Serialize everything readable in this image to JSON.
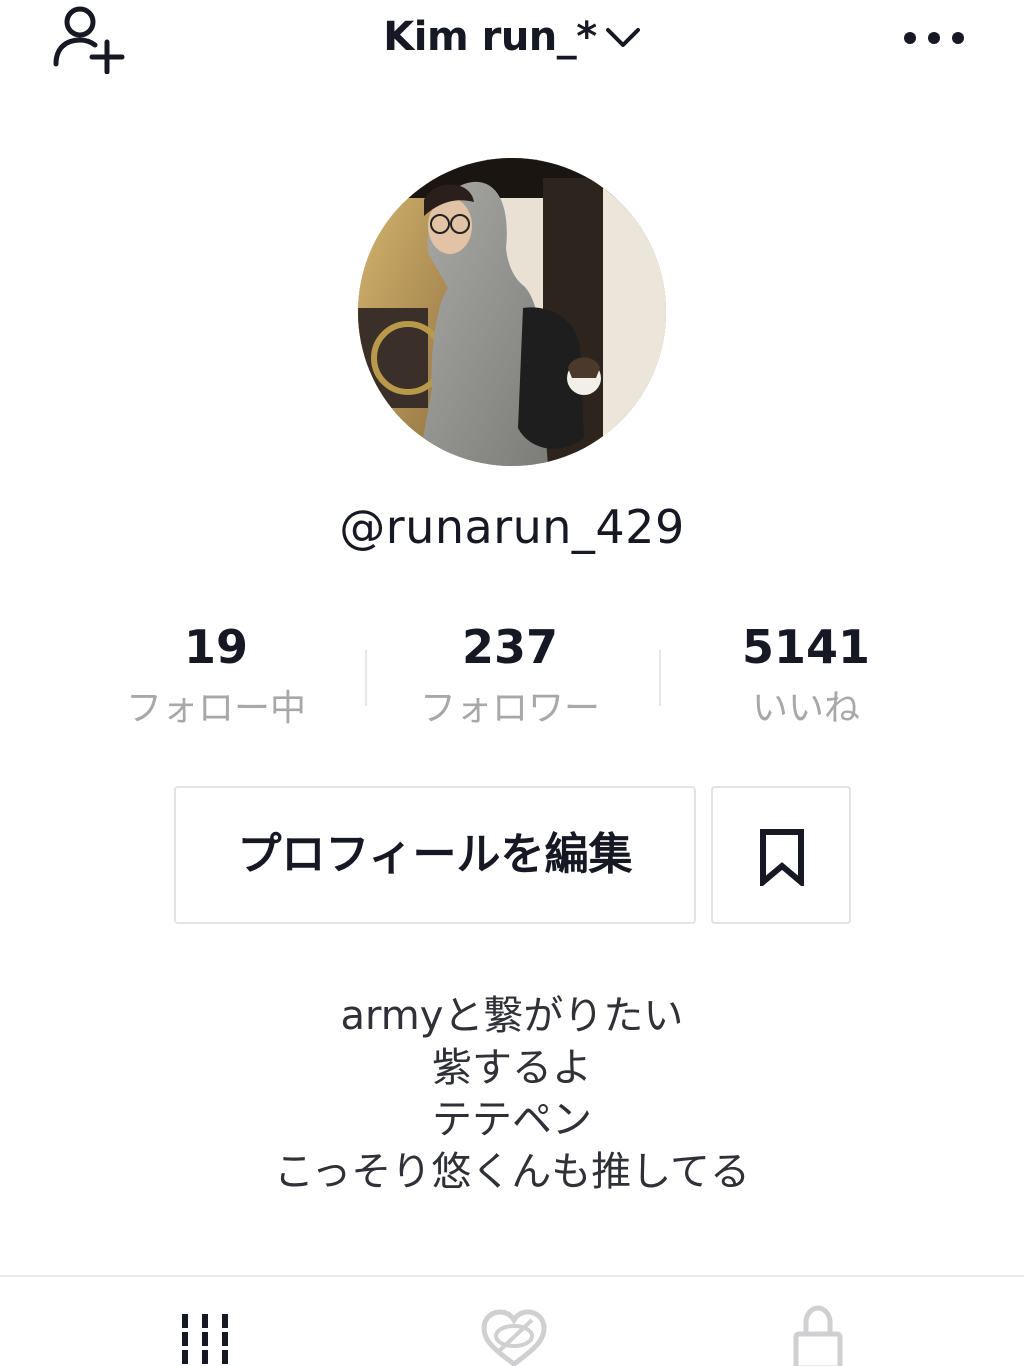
{
  "header": {
    "title": "Kim run_*",
    "add_friend_icon": "person-plus-icon",
    "more_icon": "more-horizontal-icon",
    "dropdown_icon": "chevron-down-icon"
  },
  "profile": {
    "handle": "@runarun_429",
    "avatar_icon": "profile-photo"
  },
  "stats": [
    {
      "value": "19",
      "label": "フォロー中"
    },
    {
      "value": "237",
      "label": "フォロワー"
    },
    {
      "value": "5141",
      "label": "いいね"
    }
  ],
  "actions": {
    "edit_profile_label": "プロフィールを編集",
    "bookmark_icon": "bookmark-icon"
  },
  "bio": {
    "lines": [
      "armyと繋がりたい",
      "紫するよ",
      "テテペン",
      "こっそり悠くんも推してる"
    ]
  },
  "tabs": [
    {
      "name": "videos",
      "icon": "grid-icon",
      "active": true
    },
    {
      "name": "liked",
      "icon": "heart-hidden-icon",
      "active": false
    },
    {
      "name": "private",
      "icon": "lock-icon",
      "active": false
    }
  ],
  "colors": {
    "text_primary": "#161823",
    "text_secondary": "#a8a8ab",
    "border": "#e3e3e4",
    "inactive_icon": "#d0d0d2"
  }
}
